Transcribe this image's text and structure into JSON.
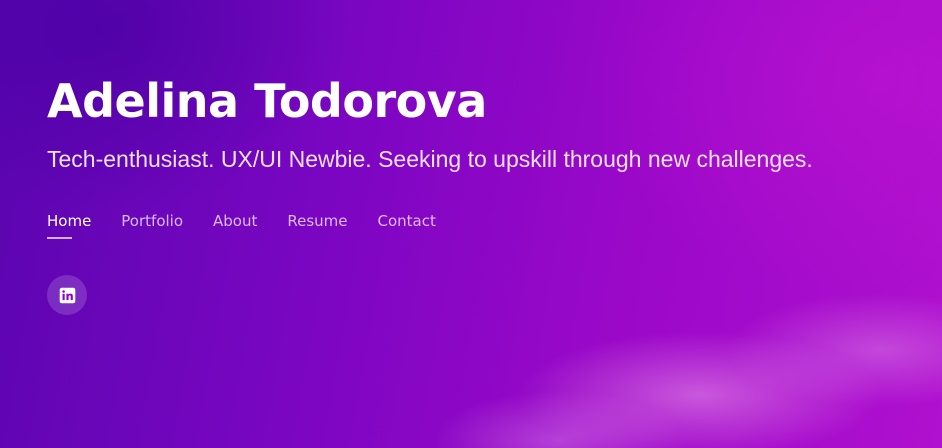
{
  "hero": {
    "name": "Adelina Todorova",
    "tagline": "Tech-enthusiast. UX/UI Newbie. Seeking to upskill through new challenges."
  },
  "nav": {
    "items": [
      {
        "label": "Home",
        "active": true
      },
      {
        "label": "Portfolio",
        "active": false
      },
      {
        "label": "About",
        "active": false
      },
      {
        "label": "Resume",
        "active": false
      },
      {
        "label": "Contact",
        "active": false
      }
    ]
  },
  "social": {
    "links": [
      {
        "icon": "linkedin-icon"
      }
    ]
  },
  "colors": {
    "background_start": "#5a05b0",
    "background_end": "#b010cf",
    "text": "#ffffff"
  }
}
